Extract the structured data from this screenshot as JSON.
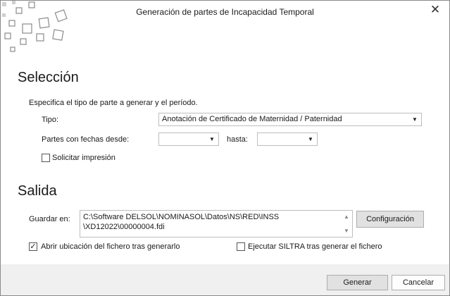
{
  "window": {
    "title": "Generación de partes de Incapacidad Temporal",
    "close_glyph": "✕"
  },
  "seleccion": {
    "heading": "Selección",
    "description": "Especifica el tipo de parte a generar y el período.",
    "tipo_label": "Tipo:",
    "tipo_value": "Anotación de Certificado de Maternidad / Paternidad",
    "desde_label": "Partes con fechas desde:",
    "desde_value": "",
    "hasta_label": "hasta:",
    "hasta_value": "",
    "imprimir_label": "Solicitar impresión",
    "imprimir_checked": false
  },
  "salida": {
    "heading": "Salida",
    "guardar_label": "Guardar en:",
    "path_line1": "C:\\Software DELSOL\\NOMINASOL\\Datos\\NS\\RED\\INSS",
    "path_line2": "\\XD12022\\00000004.fdi",
    "config_button": "Configuración",
    "abrir_label": "Abrir ubicación del fichero tras generarlo",
    "abrir_checked": true,
    "siltra_label": "Ejecutar SILTRA tras generar el fichero",
    "siltra_checked": false
  },
  "footer": {
    "generar_button": "Generar",
    "cancelar_button": "Cancelar"
  },
  "icons": {
    "dropdown": "▼",
    "check": "✓",
    "scroll_up": "▲",
    "scroll_down": "▼"
  }
}
